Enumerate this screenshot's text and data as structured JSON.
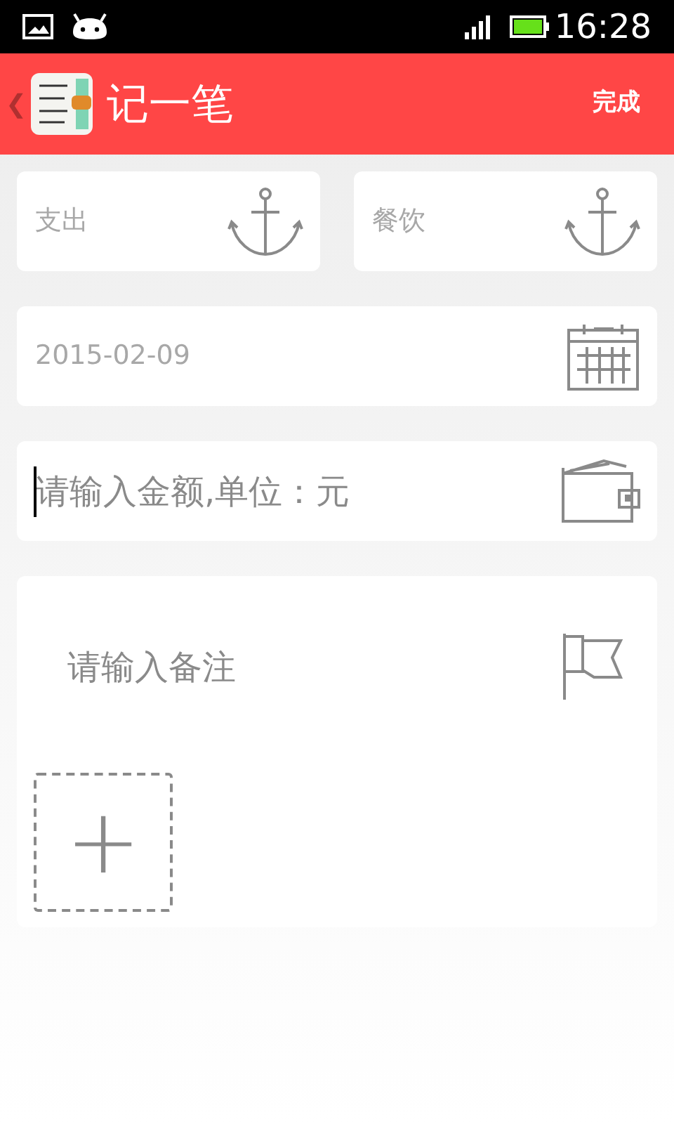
{
  "status_bar": {
    "time": "16:28"
  },
  "app_bar": {
    "back": "❮",
    "title": "记一笔",
    "action": "完成"
  },
  "selectors": [
    {
      "value": "支出"
    },
    {
      "value": "餐饮"
    }
  ],
  "date_field": {
    "value": "2015-02-09"
  },
  "amount_field": {
    "placeholder": "请输入金额,单位：元",
    "focused": true
  },
  "note_field": {
    "placeholder": "请输入备注"
  },
  "add_photo": {
    "label": "+"
  }
}
